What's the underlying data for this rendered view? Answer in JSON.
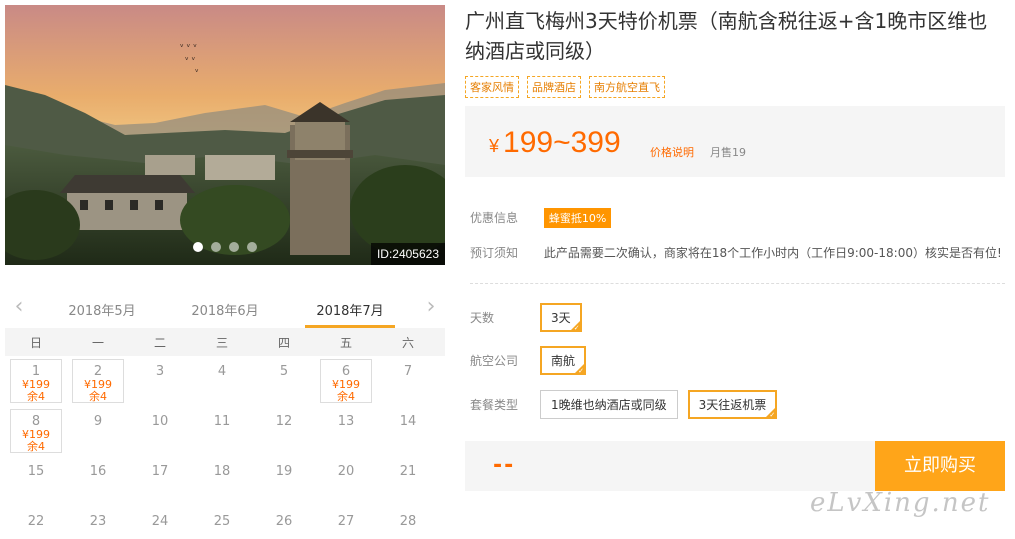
{
  "hero": {
    "image_label": "id-photo-village-sunset",
    "id_text": "ID:2405623",
    "dots": 4,
    "active_dot": 1
  },
  "product": {
    "title": "广州直飞梅州3天特价机票（南航含税往返+含1晚市区维也纳酒店或同级）",
    "tags": [
      "客家风情",
      "品牌酒店",
      "南方航空直飞"
    ],
    "price_symbol": "¥",
    "price_range": "199~399",
    "price_note": "价格说明",
    "sold": "月售19"
  },
  "info": {
    "promo_label": "优惠信息",
    "promo_badge": "蜂蜜抵10%",
    "notice_label": "预订须知",
    "notice_text": "此产品需要二次确认，商家将在18个工作小时内（工作日9:00-18:00）核实是否有位!"
  },
  "options": {
    "days_label": "天数",
    "days": [
      {
        "label": "3天",
        "selected": true
      }
    ],
    "airline_label": "航空公司",
    "airlines": [
      {
        "label": "南航",
        "selected": true
      }
    ],
    "package_label": "套餐类型",
    "packages": [
      {
        "label": "1晚维也纳酒店或同级",
        "selected": false
      },
      {
        "label": "3天往返机票",
        "selected": true
      }
    ]
  },
  "buy": {
    "placeholder": "--",
    "button": "立即购买"
  },
  "calendar": {
    "months": [
      "2018年5月",
      "2018年6月",
      "2018年7月"
    ],
    "active_month": "2018年7月",
    "weekdays": [
      "日",
      "一",
      "二",
      "三",
      "四",
      "五",
      "六"
    ],
    "cells": [
      {
        "day": "1",
        "price": "¥199",
        "stock": "余4"
      },
      {
        "day": "2",
        "price": "¥199",
        "stock": "余4"
      },
      {
        "day": "3"
      },
      {
        "day": "4"
      },
      {
        "day": "5"
      },
      {
        "day": "6",
        "price": "¥199",
        "stock": "余4"
      },
      {
        "day": "7"
      },
      {
        "day": "8",
        "price": "¥199",
        "stock": "余4"
      },
      {
        "day": "9"
      },
      {
        "day": "10"
      },
      {
        "day": "11"
      },
      {
        "day": "12"
      },
      {
        "day": "13"
      },
      {
        "day": "14"
      },
      {
        "day": "15"
      },
      {
        "day": "16"
      },
      {
        "day": "17"
      },
      {
        "day": "18"
      },
      {
        "day": "19"
      },
      {
        "day": "20"
      },
      {
        "day": "21"
      },
      {
        "day": "22"
      },
      {
        "day": "23"
      },
      {
        "day": "24"
      },
      {
        "day": "25"
      },
      {
        "day": "26"
      },
      {
        "day": "27"
      },
      {
        "day": "28"
      }
    ]
  },
  "watermark": "eLvXing.net",
  "colors": {
    "accent": "#ff6a00",
    "button": "#ffa519",
    "tag_border": "#f5a623"
  }
}
